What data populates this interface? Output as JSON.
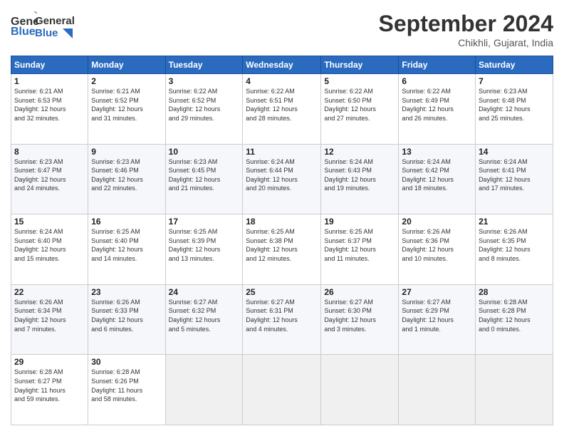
{
  "header": {
    "logo_line1": "General",
    "logo_line2": "Blue",
    "month_title": "September 2024",
    "location": "Chikhli, Gujarat, India"
  },
  "days_of_week": [
    "Sunday",
    "Monday",
    "Tuesday",
    "Wednesday",
    "Thursday",
    "Friday",
    "Saturday"
  ],
  "weeks": [
    [
      {
        "day": "1",
        "info": "Sunrise: 6:21 AM\nSunset: 6:53 PM\nDaylight: 12 hours\nand 32 minutes."
      },
      {
        "day": "2",
        "info": "Sunrise: 6:21 AM\nSunset: 6:52 PM\nDaylight: 12 hours\nand 31 minutes."
      },
      {
        "day": "3",
        "info": "Sunrise: 6:22 AM\nSunset: 6:52 PM\nDaylight: 12 hours\nand 29 minutes."
      },
      {
        "day": "4",
        "info": "Sunrise: 6:22 AM\nSunset: 6:51 PM\nDaylight: 12 hours\nand 28 minutes."
      },
      {
        "day": "5",
        "info": "Sunrise: 6:22 AM\nSunset: 6:50 PM\nDaylight: 12 hours\nand 27 minutes."
      },
      {
        "day": "6",
        "info": "Sunrise: 6:22 AM\nSunset: 6:49 PM\nDaylight: 12 hours\nand 26 minutes."
      },
      {
        "day": "7",
        "info": "Sunrise: 6:23 AM\nSunset: 6:48 PM\nDaylight: 12 hours\nand 25 minutes."
      }
    ],
    [
      {
        "day": "8",
        "info": "Sunrise: 6:23 AM\nSunset: 6:47 PM\nDaylight: 12 hours\nand 24 minutes."
      },
      {
        "day": "9",
        "info": "Sunrise: 6:23 AM\nSunset: 6:46 PM\nDaylight: 12 hours\nand 22 minutes."
      },
      {
        "day": "10",
        "info": "Sunrise: 6:23 AM\nSunset: 6:45 PM\nDaylight: 12 hours\nand 21 minutes."
      },
      {
        "day": "11",
        "info": "Sunrise: 6:24 AM\nSunset: 6:44 PM\nDaylight: 12 hours\nand 20 minutes."
      },
      {
        "day": "12",
        "info": "Sunrise: 6:24 AM\nSunset: 6:43 PM\nDaylight: 12 hours\nand 19 minutes."
      },
      {
        "day": "13",
        "info": "Sunrise: 6:24 AM\nSunset: 6:42 PM\nDaylight: 12 hours\nand 18 minutes."
      },
      {
        "day": "14",
        "info": "Sunrise: 6:24 AM\nSunset: 6:41 PM\nDaylight: 12 hours\nand 17 minutes."
      }
    ],
    [
      {
        "day": "15",
        "info": "Sunrise: 6:24 AM\nSunset: 6:40 PM\nDaylight: 12 hours\nand 15 minutes."
      },
      {
        "day": "16",
        "info": "Sunrise: 6:25 AM\nSunset: 6:40 PM\nDaylight: 12 hours\nand 14 minutes."
      },
      {
        "day": "17",
        "info": "Sunrise: 6:25 AM\nSunset: 6:39 PM\nDaylight: 12 hours\nand 13 minutes."
      },
      {
        "day": "18",
        "info": "Sunrise: 6:25 AM\nSunset: 6:38 PM\nDaylight: 12 hours\nand 12 minutes."
      },
      {
        "day": "19",
        "info": "Sunrise: 6:25 AM\nSunset: 6:37 PM\nDaylight: 12 hours\nand 11 minutes."
      },
      {
        "day": "20",
        "info": "Sunrise: 6:26 AM\nSunset: 6:36 PM\nDaylight: 12 hours\nand 10 minutes."
      },
      {
        "day": "21",
        "info": "Sunrise: 6:26 AM\nSunset: 6:35 PM\nDaylight: 12 hours\nand 8 minutes."
      }
    ],
    [
      {
        "day": "22",
        "info": "Sunrise: 6:26 AM\nSunset: 6:34 PM\nDaylight: 12 hours\nand 7 minutes."
      },
      {
        "day": "23",
        "info": "Sunrise: 6:26 AM\nSunset: 6:33 PM\nDaylight: 12 hours\nand 6 minutes."
      },
      {
        "day": "24",
        "info": "Sunrise: 6:27 AM\nSunset: 6:32 PM\nDaylight: 12 hours\nand 5 minutes."
      },
      {
        "day": "25",
        "info": "Sunrise: 6:27 AM\nSunset: 6:31 PM\nDaylight: 12 hours\nand 4 minutes."
      },
      {
        "day": "26",
        "info": "Sunrise: 6:27 AM\nSunset: 6:30 PM\nDaylight: 12 hours\nand 3 minutes."
      },
      {
        "day": "27",
        "info": "Sunrise: 6:27 AM\nSunset: 6:29 PM\nDaylight: 12 hours\nand 1 minute."
      },
      {
        "day": "28",
        "info": "Sunrise: 6:28 AM\nSunset: 6:28 PM\nDaylight: 12 hours\nand 0 minutes."
      }
    ],
    [
      {
        "day": "29",
        "info": "Sunrise: 6:28 AM\nSunset: 6:27 PM\nDaylight: 11 hours\nand 59 minutes."
      },
      {
        "day": "30",
        "info": "Sunrise: 6:28 AM\nSunset: 6:26 PM\nDaylight: 11 hours\nand 58 minutes."
      },
      null,
      null,
      null,
      null,
      null
    ]
  ]
}
